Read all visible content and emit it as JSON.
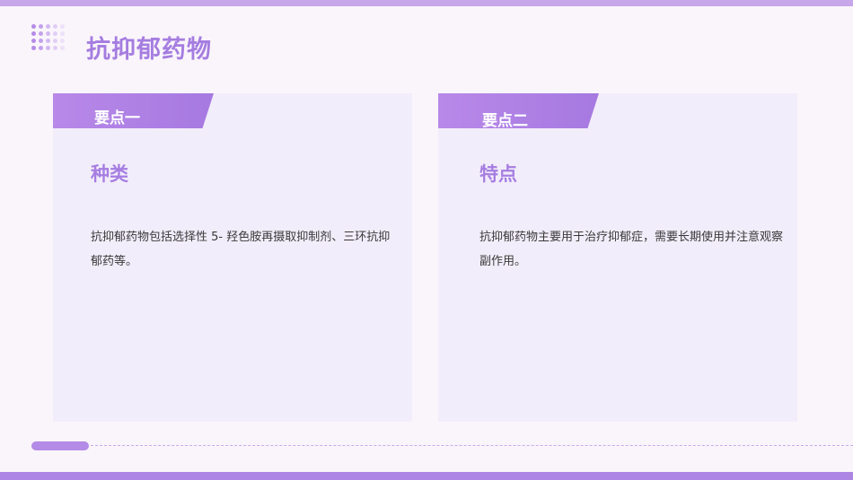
{
  "slide": {
    "title": "抗抑郁药物"
  },
  "cards": [
    {
      "tab": "要点一",
      "heading": "种类",
      "body": "抗抑郁药物包括选择性 5- 羟色胺再摄取抑制剂、三环抗抑郁药等。"
    },
    {
      "tab": "要点二",
      "heading": "特点",
      "body": "抗抑郁药物主要用于治疗抑郁症，需要长期使用并注意观察副作用。"
    }
  ],
  "colors": {
    "accent": "#a67ee1",
    "tab": "#b18ae6",
    "card_bg": "#f2edfa",
    "page_bg": "#faf5fb"
  },
  "icons": [
    "dot-grid-decoration"
  ]
}
